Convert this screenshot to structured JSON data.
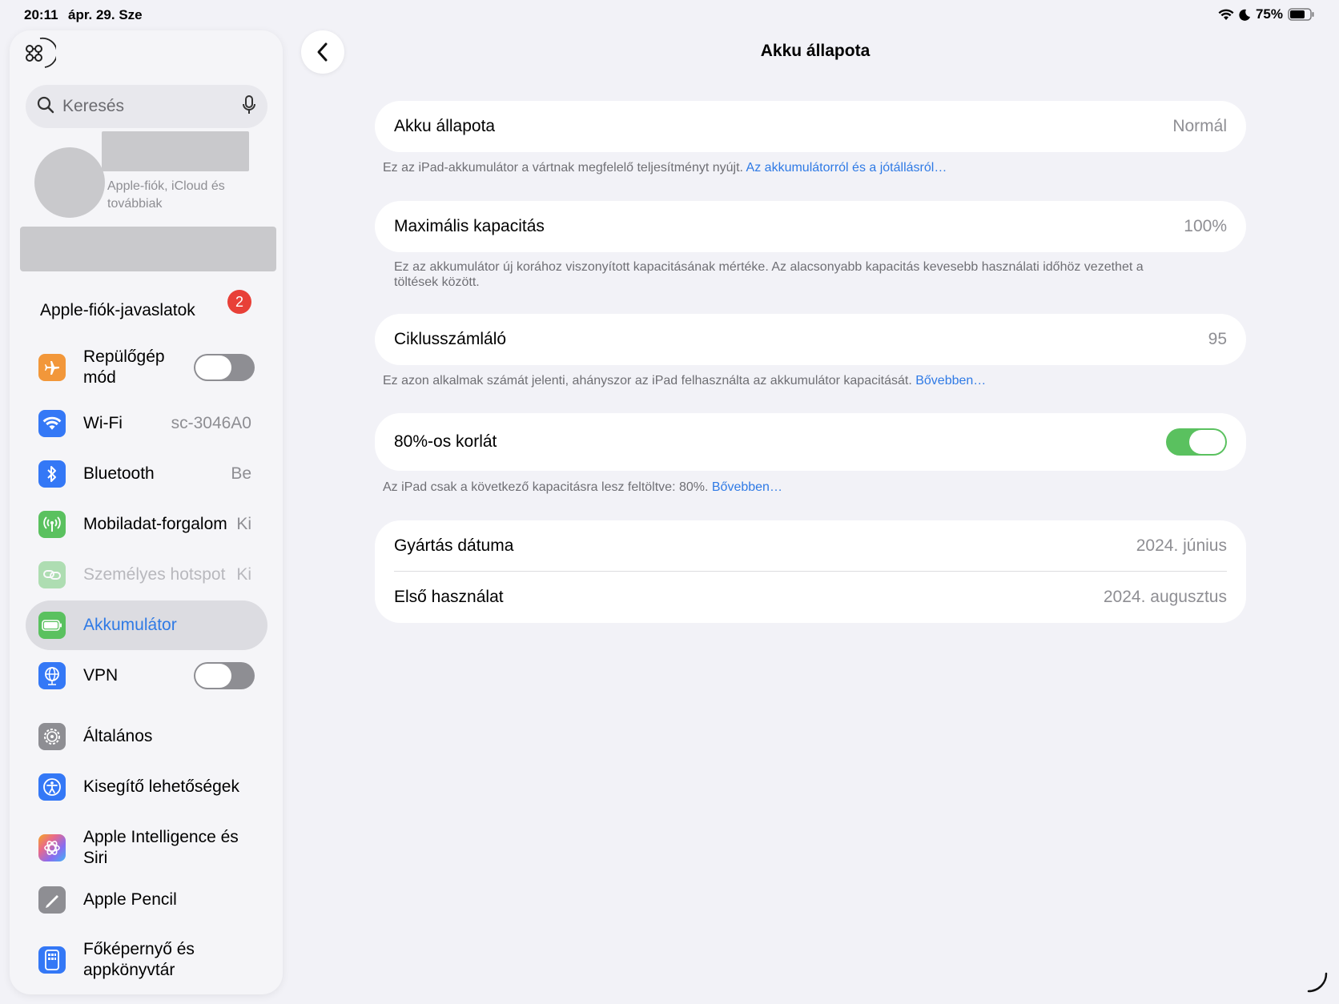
{
  "status_bar": {
    "time": "20:11",
    "date": "ápr. 29. Sze",
    "battery": "75%"
  },
  "sidebar": {
    "search_placeholder": "Keresés",
    "profile_subtitle": "Apple-fiók, iCloud és továbbiak",
    "suggestions_label": "Apple-fiók-javaslatok",
    "suggestions_badge": "2",
    "items": [
      {
        "label": "Repülőgép mód",
        "icon": "airplane-icon",
        "color": "#f2973a",
        "toggle": false
      },
      {
        "label": "Wi-Fi",
        "value": "sc-3046A0",
        "icon": "wifi-icon",
        "color": "#3478f6"
      },
      {
        "label": "Bluetooth",
        "value": "Be",
        "icon": "bluetooth-icon",
        "color": "#3478f6"
      },
      {
        "label": "Mobiladat-forgalom",
        "value": "Ki",
        "icon": "antenna-icon",
        "color": "#5ac15f"
      },
      {
        "label": "Személyes hotspot",
        "value": "Ki",
        "icon": "hotspot-icon",
        "color": "#5ac15f",
        "disabled": true
      },
      {
        "label": "Akkumulátor",
        "icon": "battery-icon",
        "color": "#5ac15f",
        "selected": true
      },
      {
        "label": "VPN",
        "icon": "globe-icon",
        "color": "#3478f6",
        "toggle": false
      },
      {
        "label": "Általános",
        "icon": "gear-icon",
        "color": "#8e8e93"
      },
      {
        "label": "Kisegítő lehetőségek",
        "icon": "accessibility-icon",
        "color": "#3478f6"
      },
      {
        "label": "Apple Intelligence és Siri",
        "icon": "siri-icon",
        "color": "#e86a8b"
      },
      {
        "label": "Apple Pencil",
        "icon": "pencil-icon",
        "color": "#8e8e93"
      },
      {
        "label": "Főképernyő és appkönyvtár",
        "icon": "homescreen-icon",
        "color": "#3478f6"
      }
    ]
  },
  "main": {
    "title": "Akku állapota",
    "battery_state": {
      "label": "Akku állapota",
      "value": "Normál"
    },
    "battery_state_note": "Ez az iPad-akkumulátor a vártnak megfelelő teljesítményt nyújt.",
    "battery_state_link": "Az akkumulátorról és a jótállásról…",
    "max_capacity": {
      "label": "Maximális kapacitás",
      "value": "100%"
    },
    "max_capacity_note": "Ez az akkumulátor új korához viszonyított kapacitásának mértéke. Az alacsonyabb kapacitás kevesebb használati időhöz vezethet a töltések között.",
    "cycle_count": {
      "label": "Ciklusszámláló",
      "value": "95"
    },
    "cycle_count_note": "Ez azon alkalmak számát jelenti, ahányszor az iPad felhasználta az akkumulátor kapacitását.",
    "cycle_count_link": "Bővebben…",
    "limit": {
      "label": "80%-os korlát",
      "on": true
    },
    "limit_note": "Az iPad csak a következő kapacitásra lesz feltöltve: 80%.",
    "limit_link": "Bővebben…",
    "manufacture": {
      "label": "Gyártás dátuma",
      "value": "2024. június"
    },
    "first_use": {
      "label": "Első használat",
      "value": "2024. augusztus"
    }
  }
}
